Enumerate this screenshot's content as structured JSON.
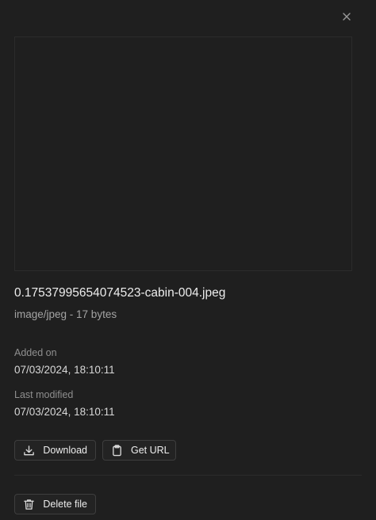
{
  "file": {
    "name": "0.17537995654074523-cabin-004.jpeg",
    "meta": "image/jpeg - 17 bytes"
  },
  "details": {
    "added_label": "Added on",
    "added_value": "07/03/2024, 18:10:11",
    "modified_label": "Last modified",
    "modified_value": "07/03/2024, 18:10:11"
  },
  "actions": {
    "download_label": "Download",
    "get_url_label": "Get URL",
    "delete_label": "Delete file"
  },
  "icons": {
    "close": "close-icon",
    "download": "download-icon",
    "clipboard": "clipboard-icon",
    "trash": "trash-icon"
  },
  "colors": {
    "background": "#1f1f1f",
    "text": "#ededed",
    "muted": "#8f8f8f",
    "border": "#3e3e3e"
  }
}
